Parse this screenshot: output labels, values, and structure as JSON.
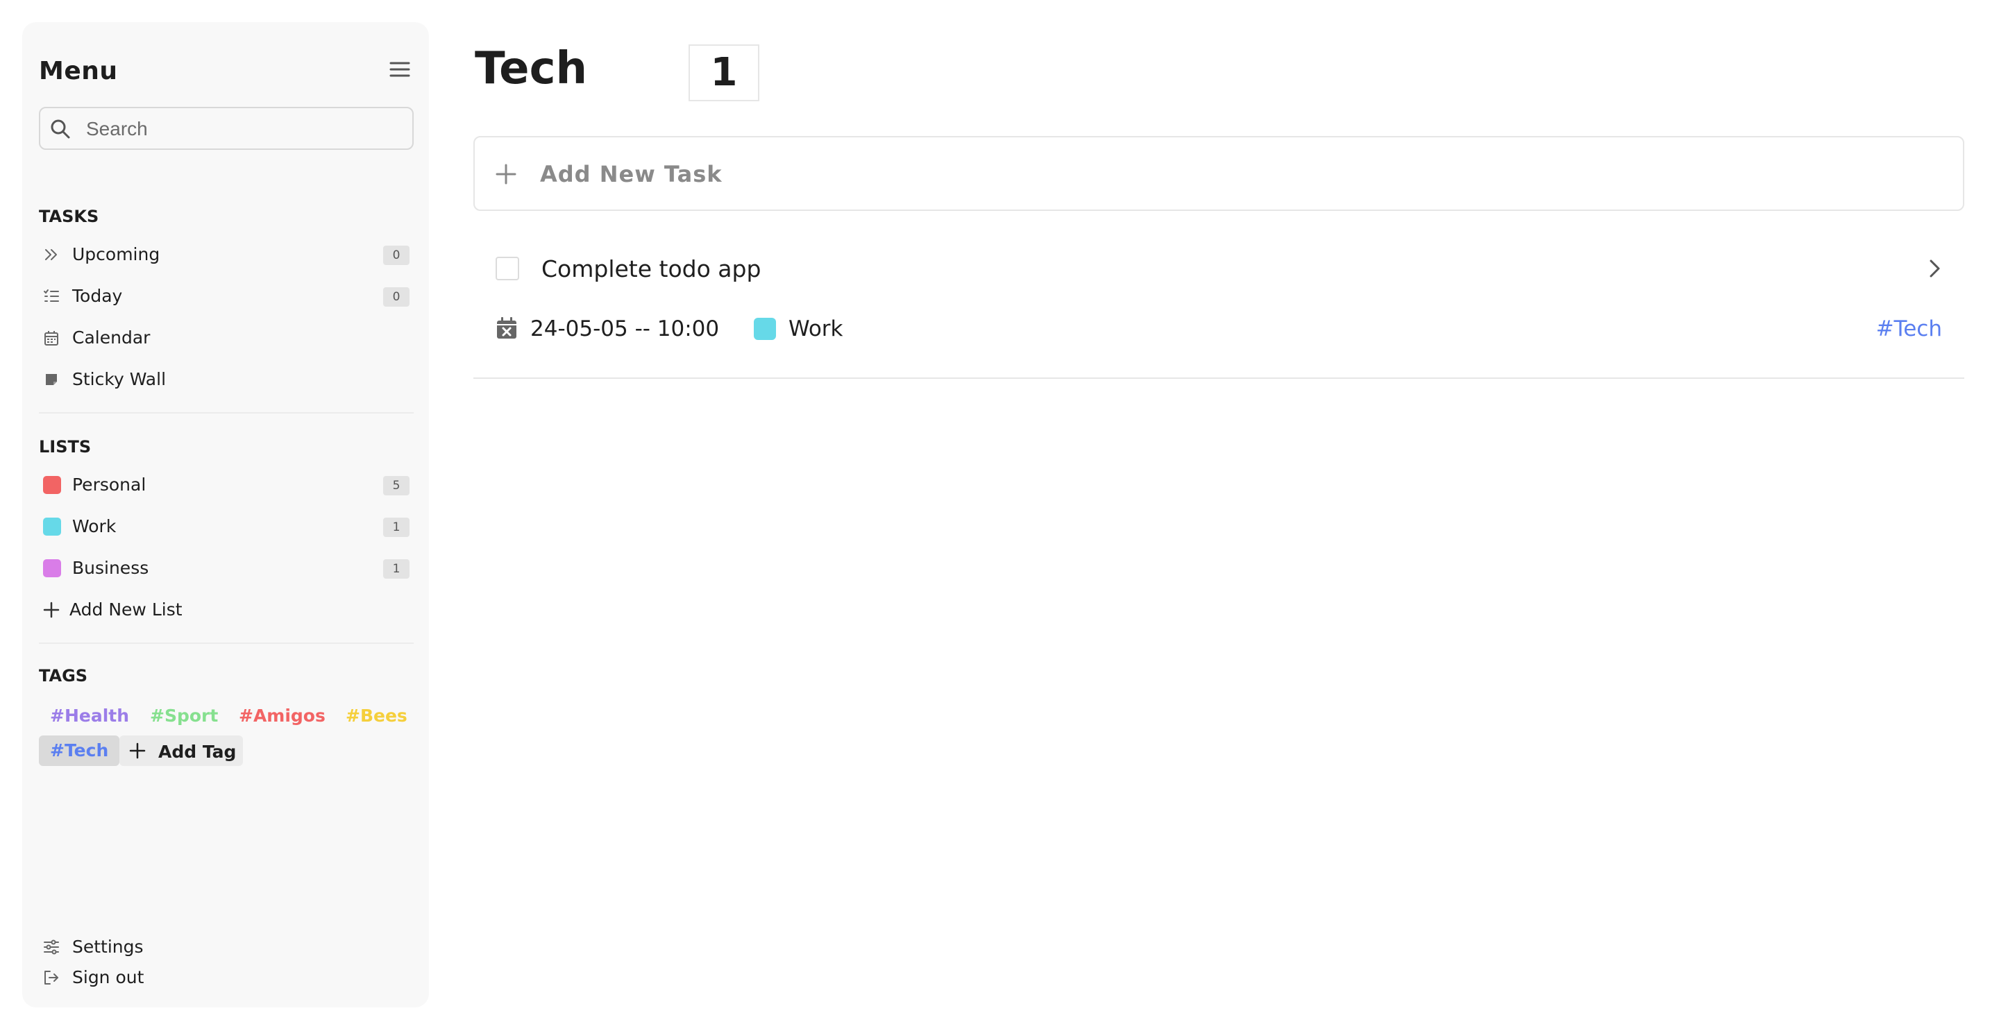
{
  "sidebar": {
    "title": "Menu",
    "search": {
      "placeholder": "Search",
      "value": ""
    },
    "tasks": {
      "heading": "TASKS",
      "items": [
        {
          "label": "Upcoming",
          "count": "0",
          "icon": "double-chevron-right-icon"
        },
        {
          "label": "Today",
          "count": "0",
          "icon": "checklist-icon"
        },
        {
          "label": "Calendar",
          "icon": "calendar-icon"
        },
        {
          "label": "Sticky Wall",
          "icon": "sticky-note-icon"
        }
      ]
    },
    "lists": {
      "heading": "LISTS",
      "items": [
        {
          "label": "Personal",
          "count": "5",
          "color": "#f26464"
        },
        {
          "label": "Work",
          "count": "1",
          "color": "#66d9e8"
        },
        {
          "label": "Business",
          "count": "1",
          "color": "#d97de8"
        }
      ],
      "add_label": "Add New List"
    },
    "tags": {
      "heading": "TAGS",
      "items": [
        {
          "label": "#Health",
          "color": "#9b7de8"
        },
        {
          "label": "#Sport",
          "color": "#86e08f"
        },
        {
          "label": "#Amigos",
          "color": "#f26464"
        },
        {
          "label": "#Bees",
          "color": "#f5cf3c"
        },
        {
          "label": "#Tech",
          "color": "#5b7ff0",
          "active": true
        }
      ],
      "add_label": "Add Tag"
    },
    "footer": {
      "settings": "Settings",
      "signout": "Sign out"
    }
  },
  "main": {
    "title": "Tech",
    "count": "1",
    "add_task_label": "Add New Task",
    "tasks": [
      {
        "title": "Complete todo app",
        "date": "24-05-05 -- 10:00",
        "list": "Work",
        "list_color": "#66d9e8",
        "tag": "#Tech",
        "tag_color": "#5b7ff0",
        "completed": false
      }
    ]
  }
}
